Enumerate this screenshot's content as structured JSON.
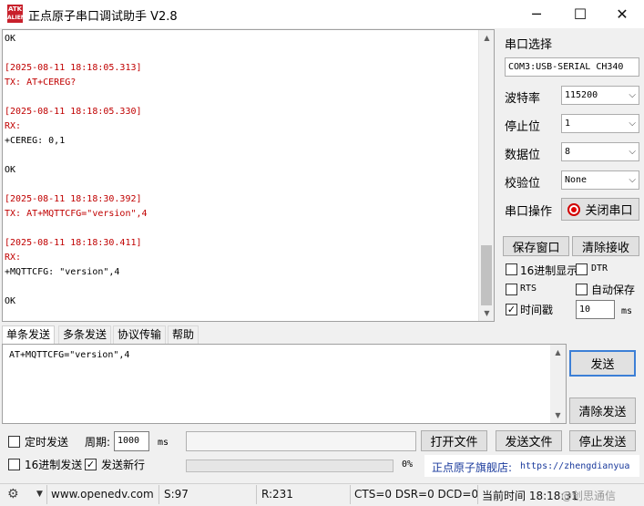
{
  "window": {
    "logo_text": "ATK",
    "title": "正点原子串口调试助手 V2.8",
    "minimize_glyph": "─",
    "maximize_glyph": "☐",
    "close_glyph": "✕"
  },
  "receive": {
    "lines": [
      {
        "text": "OK",
        "color": "#000000"
      },
      {
        "text": "",
        "color": "#000000"
      },
      {
        "text": "[2025-08-11 18:18:05.313]",
        "color": "#c00000"
      },
      {
        "text": "TX: AT+CEREG?",
        "color": "#c00000"
      },
      {
        "text": "",
        "color": "#000000"
      },
      {
        "text": "[2025-08-11 18:18:05.330]",
        "color": "#c00000"
      },
      {
        "text": "RX:",
        "color": "#c00000"
      },
      {
        "text": "+CEREG: 0,1",
        "color": "#000000"
      },
      {
        "text": "",
        "color": "#000000"
      },
      {
        "text": "OK",
        "color": "#000000"
      },
      {
        "text": "",
        "color": "#000000"
      },
      {
        "text": "[2025-08-11 18:18:30.392]",
        "color": "#c00000"
      },
      {
        "text": "TX: AT+MQTTCFG=\"version\",4",
        "color": "#c00000"
      },
      {
        "text": "",
        "color": "#000000"
      },
      {
        "text": "[2025-08-11 18:18:30.411]",
        "color": "#c00000"
      },
      {
        "text": "RX:",
        "color": "#c00000"
      },
      {
        "text": "+MQTTCFG: \"version\",4",
        "color": "#000000"
      },
      {
        "text": "",
        "color": "#000000"
      },
      {
        "text": "OK",
        "color": "#000000"
      }
    ]
  },
  "port": {
    "section_label": "串口选择",
    "port_value": "COM3:USB-SERIAL CH340",
    "baud_label": "波特率",
    "baud_value": "115200",
    "stop_label": "停止位",
    "stop_value": "1",
    "data_label": "数据位",
    "data_value": "8",
    "parity_label": "校验位",
    "parity_value": "None",
    "op_label": "串口操作",
    "close_port_button": "关闭串口"
  },
  "recv_options": {
    "save_window": "保存窗口",
    "clear_receive": "清除接收",
    "hex_display": "16进制显示",
    "dtr": "DTR",
    "rts": "RTS",
    "auto_save": "自动保存",
    "timestamp": "时间戳",
    "timestamp_ms_value": "10",
    "ms_unit": "ms",
    "hex_display_checked": false,
    "dtr_checked": false,
    "rts_checked": false,
    "auto_save_checked": false,
    "timestamp_checked": true
  },
  "tabs": [
    "单条发送",
    "多条发送",
    "协议传输",
    "帮助"
  ],
  "send": {
    "text": "AT+MQTTCFG=\"version\",4",
    "send_button": "发送",
    "clear_send_button": "清除发送",
    "timed_send": "定时发送",
    "period_label": "周期:",
    "period_value": "1000",
    "period_unit": "ms",
    "open_file": "打开文件",
    "send_file": "发送文件",
    "stop_send": "停止发送",
    "hex_send": "16进制发送",
    "send_newline": "发送新行",
    "progress_percent": "0%",
    "progress": 0,
    "store_text": "正点原子旗舰店:",
    "store_url": "https://zhengdianyua",
    "timed_send_checked": false,
    "hex_send_checked": false,
    "send_newline_checked": true
  },
  "status": {
    "website": "www.openedv.com",
    "sent": "S:97",
    "received": "R:231",
    "signals": "CTS=0 DSR=0 DCD=0",
    "time": "当前时间 18:18:31",
    "watermark": "@创思通信"
  }
}
